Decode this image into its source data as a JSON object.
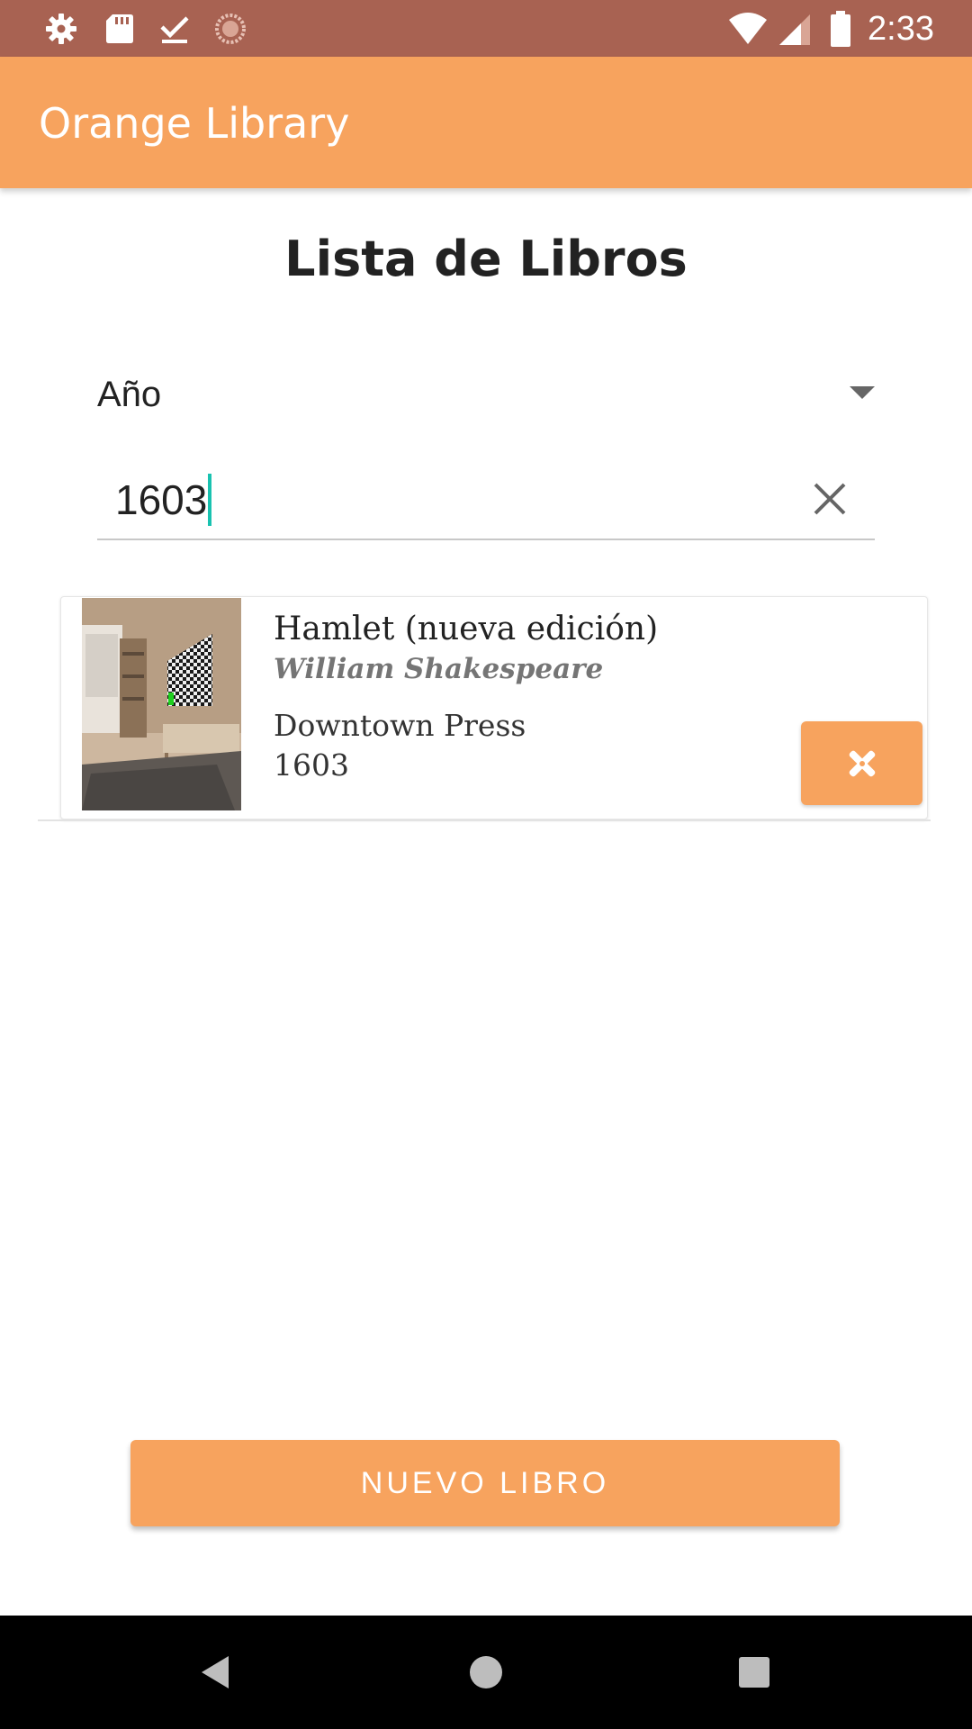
{
  "status_bar": {
    "time": "2:33",
    "left_icons": [
      "settings-icon",
      "sd-card-icon",
      "download-done-icon",
      "sync-icon"
    ],
    "right_icons": [
      "wifi-icon",
      "signal-icon",
      "battery-icon"
    ],
    "background": "#a86252"
  },
  "app_bar": {
    "title": "Orange Library",
    "background": "#f7a35e"
  },
  "page": {
    "title": "Lista de Libros"
  },
  "filter": {
    "selected": "Año",
    "search_value": "1603"
  },
  "books": [
    {
      "title": "Hamlet (nueva edición)",
      "author": "William Shakespeare",
      "publisher": "Downtown Press",
      "year": "1603",
      "action_icon": "edit-tools-icon"
    }
  ],
  "actions": {
    "new_book_label": "NUEVO LIBRO"
  },
  "nav_bar": {
    "buttons": [
      "back-icon",
      "home-icon",
      "recents-icon"
    ]
  },
  "colors": {
    "accent": "#f7a35e",
    "caret": "#19c2b0",
    "status_bar": "#a86252"
  }
}
